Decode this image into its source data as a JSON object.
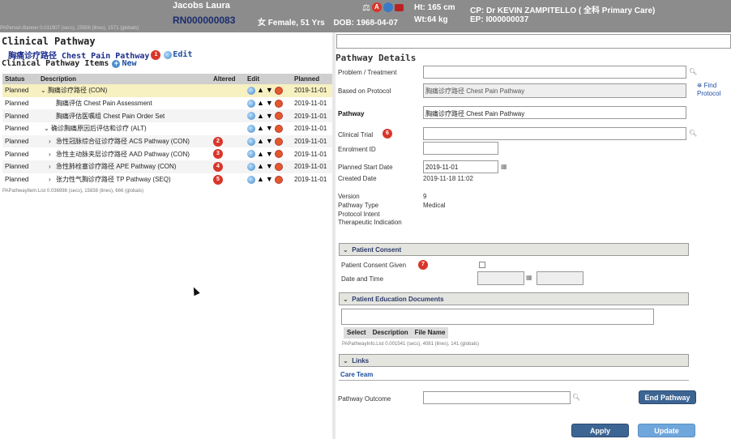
{
  "banner": {
    "patient_name": "Jacobs Laura",
    "patient_id": "RN000000083",
    "gender_age": "女 Female, 51 Yrs",
    "dob": "DOB: 1968-04-07",
    "weight": "Wt:64 kg",
    "height": "Ht: 165 cm",
    "care_provider": "CP: Dr KEVIN ZAMPITELLO ( 全科 Primary Care)",
    "episode": "EP: I000000037",
    "sub_stats": "PAPerson.Banner  0.011907 (secs),  25506 (lines),  1571 (globals)"
  },
  "left": {
    "title": "Clinical Pathway",
    "pathway_name": "胸痛诊疗路径 Chest Pain Pathway",
    "edit_label": "Edit",
    "items_title": "Clinical Pathway Items",
    "new_label": "New",
    "columns": [
      "Status",
      "Description",
      "Altered",
      "Edit",
      "Planned"
    ],
    "rows": [
      {
        "status": "Planned",
        "description": "胸痛诊疗路径 (CON)",
        "indent": 0,
        "chevron": "down",
        "badge": "",
        "planned": "2019-11-01",
        "selected": true
      },
      {
        "status": "Planned",
        "description": "胸痛评估 Chest Pain Assessment",
        "indent": 2,
        "chevron": "",
        "badge": "",
        "planned": "2019-11-01",
        "selected": false
      },
      {
        "status": "Planned",
        "description": "胸痛评估医嘱组 Chest Pain Order Set",
        "indent": 2,
        "chevron": "",
        "badge": "",
        "planned": "2019-11-01",
        "selected": false
      },
      {
        "status": "Planned",
        "description": "确诊胸痛原因后评估和诊疗 (ALT)",
        "indent": 1,
        "chevron": "down",
        "badge": "",
        "planned": "2019-11-01",
        "selected": false
      },
      {
        "status": "Planned",
        "description": "急性冠脉综合征诊疗路径 ACS Pathway (CON)",
        "indent": 2,
        "chevron": "right",
        "badge": "2",
        "planned": "2019-11-01",
        "selected": false
      },
      {
        "status": "Planned",
        "description": "急性主动脉夹层诊疗路径 AAD Pathway (CON)",
        "indent": 2,
        "chevron": "right",
        "badge": "3",
        "planned": "2019-11-01",
        "selected": false
      },
      {
        "status": "Planned",
        "description": "急性肺栓塞诊疗路径 APE Pathway (CON)",
        "indent": 2,
        "chevron": "right",
        "badge": "4",
        "planned": "2019-11-01",
        "selected": false
      },
      {
        "status": "Planned",
        "description": "张力性气胸诊疗路径 TP Pathway (SEQ)",
        "indent": 2,
        "chevron": "right",
        "badge": "5",
        "planned": "2019-11-01",
        "selected": false
      }
    ],
    "stats": "PAPathwayItem.List  0.036998 (secs),  15838 (lines),  666 (globals)",
    "badge1": "1"
  },
  "right": {
    "title": "Pathway Details",
    "problem_label": "Problem / Treatment",
    "protocol_label": "Based on Protocol",
    "protocol_value": "胸痛诊疗路径 Chest Pain Pathway",
    "find_protocol": "Find Protocol",
    "pathway_label": "Pathway",
    "pathway_value": "胸痛诊疗路径 Chest Pain Pathway",
    "trial_label": "Clinical Trial",
    "trial_badge": "6",
    "enrolment_label": "Enrolment ID",
    "start_label": "Planned Start Date",
    "start_value": "2019-11-01",
    "created_label": "Created Date",
    "created_value": "2019-11-18  11:02",
    "version_label": "Version",
    "version_value": "9",
    "type_label": "Pathway Type",
    "type_value": "Medical",
    "intent_label": "Protocol Intent",
    "therapeutic_label": "Therapeutic Indication",
    "consent_section": "Patient Consent",
    "consent_given_label": "Patient Consent Given",
    "consent_badge": "7",
    "date_time_label": "Date and Time",
    "edu_section": "Patient Education Documents",
    "edu_columns": [
      "Select",
      "Description",
      "File Name"
    ],
    "edu_stats": "PAPathwayInfo.List  0.001541 (secs),  4081 (lines),  141 (globals)",
    "links_section": "Links",
    "care_team": "Care Team",
    "outcome_label": "Pathway Outcome",
    "end_pathway": "End Pathway",
    "apply": "Apply",
    "update": "Update"
  }
}
